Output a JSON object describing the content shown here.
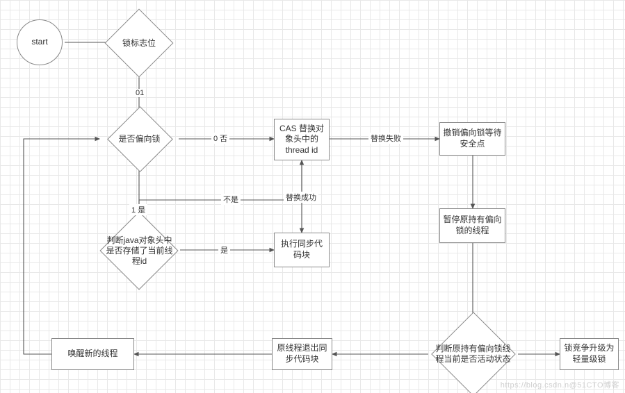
{
  "chart_data": {
    "type": "flowchart",
    "title": "",
    "nodes": [
      {
        "id": "start",
        "shape": "circle",
        "label": "start"
      },
      {
        "id": "lockbit",
        "shape": "diamond",
        "label": "锁标志位"
      },
      {
        "id": "biased",
        "shape": "diamond",
        "label": "是否偏向锁"
      },
      {
        "id": "javahd",
        "shape": "diamond",
        "label": "判断java对象头中是否存储了当前线程id"
      },
      {
        "id": "cas",
        "shape": "rect",
        "label": "CAS 替换对象头中的thread id"
      },
      {
        "id": "sync",
        "shape": "rect",
        "label": "执行同步代码块"
      },
      {
        "id": "revoke",
        "shape": "rect",
        "label": "撤销偏向锁等待安全点"
      },
      {
        "id": "pause",
        "shape": "rect",
        "label": "暂停原持有偏向锁的线程"
      },
      {
        "id": "alive",
        "shape": "diamond",
        "label": "判断原持有偏向锁线程当前是否活动状态"
      },
      {
        "id": "upgrade",
        "shape": "rect",
        "label": "锁竞争升级为轻量级锁"
      },
      {
        "id": "exit",
        "shape": "rect",
        "label": "原线程退出同步代码块"
      },
      {
        "id": "wake",
        "shape": "rect",
        "label": "唤醒新的线程"
      }
    ],
    "edges": [
      {
        "from": "start",
        "to": "lockbit",
        "label": ""
      },
      {
        "from": "lockbit",
        "to": "biased",
        "label": "01"
      },
      {
        "from": "biased",
        "to": "cas",
        "label": "0 否"
      },
      {
        "from": "biased",
        "to": "javahd",
        "label": "1 是"
      },
      {
        "from": "javahd",
        "to": "cas",
        "label": "不是"
      },
      {
        "from": "javahd",
        "to": "sync",
        "label": "是"
      },
      {
        "from": "cas",
        "to": "sync",
        "label": "替换成功"
      },
      {
        "from": "cas",
        "to": "revoke",
        "label": "替换失败"
      },
      {
        "from": "revoke",
        "to": "pause",
        "label": ""
      },
      {
        "from": "pause",
        "to": "alive",
        "label": ""
      },
      {
        "from": "alive",
        "to": "upgrade",
        "label": ""
      },
      {
        "from": "alive",
        "to": "exit",
        "label": ""
      },
      {
        "from": "exit",
        "to": "wake",
        "label": ""
      },
      {
        "from": "wake",
        "to": "biased",
        "label": ""
      }
    ]
  },
  "labels": {
    "e01": "01",
    "e0no": "0 否",
    "e1yes": "1 是",
    "eNotIs": "不是",
    "eIs": "是",
    "eReplOk": "替换成功",
    "eReplFail": "替换失败"
  },
  "watermark": "https://blog.csdn.n@51CTO博客"
}
